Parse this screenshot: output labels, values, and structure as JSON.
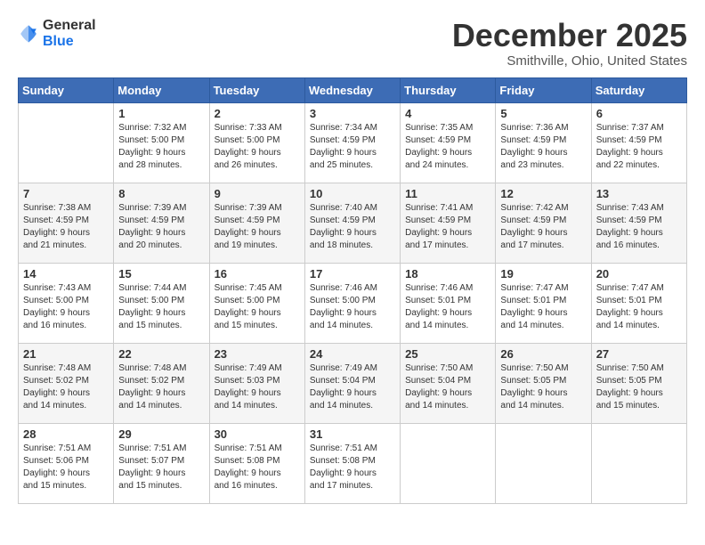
{
  "header": {
    "logo_line1": "General",
    "logo_line2": "Blue",
    "month": "December 2025",
    "location": "Smithville, Ohio, United States"
  },
  "days_of_week": [
    "Sunday",
    "Monday",
    "Tuesday",
    "Wednesday",
    "Thursday",
    "Friday",
    "Saturday"
  ],
  "weeks": [
    [
      {
        "day": "",
        "info": ""
      },
      {
        "day": "1",
        "info": "Sunrise: 7:32 AM\nSunset: 5:00 PM\nDaylight: 9 hours\nand 28 minutes."
      },
      {
        "day": "2",
        "info": "Sunrise: 7:33 AM\nSunset: 5:00 PM\nDaylight: 9 hours\nand 26 minutes."
      },
      {
        "day": "3",
        "info": "Sunrise: 7:34 AM\nSunset: 4:59 PM\nDaylight: 9 hours\nand 25 minutes."
      },
      {
        "day": "4",
        "info": "Sunrise: 7:35 AM\nSunset: 4:59 PM\nDaylight: 9 hours\nand 24 minutes."
      },
      {
        "day": "5",
        "info": "Sunrise: 7:36 AM\nSunset: 4:59 PM\nDaylight: 9 hours\nand 23 minutes."
      },
      {
        "day": "6",
        "info": "Sunrise: 7:37 AM\nSunset: 4:59 PM\nDaylight: 9 hours\nand 22 minutes."
      }
    ],
    [
      {
        "day": "7",
        "info": "Sunrise: 7:38 AM\nSunset: 4:59 PM\nDaylight: 9 hours\nand 21 minutes."
      },
      {
        "day": "8",
        "info": "Sunrise: 7:39 AM\nSunset: 4:59 PM\nDaylight: 9 hours\nand 20 minutes."
      },
      {
        "day": "9",
        "info": "Sunrise: 7:39 AM\nSunset: 4:59 PM\nDaylight: 9 hours\nand 19 minutes."
      },
      {
        "day": "10",
        "info": "Sunrise: 7:40 AM\nSunset: 4:59 PM\nDaylight: 9 hours\nand 18 minutes."
      },
      {
        "day": "11",
        "info": "Sunrise: 7:41 AM\nSunset: 4:59 PM\nDaylight: 9 hours\nand 17 minutes."
      },
      {
        "day": "12",
        "info": "Sunrise: 7:42 AM\nSunset: 4:59 PM\nDaylight: 9 hours\nand 17 minutes."
      },
      {
        "day": "13",
        "info": "Sunrise: 7:43 AM\nSunset: 4:59 PM\nDaylight: 9 hours\nand 16 minutes."
      }
    ],
    [
      {
        "day": "14",
        "info": "Sunrise: 7:43 AM\nSunset: 5:00 PM\nDaylight: 9 hours\nand 16 minutes."
      },
      {
        "day": "15",
        "info": "Sunrise: 7:44 AM\nSunset: 5:00 PM\nDaylight: 9 hours\nand 15 minutes."
      },
      {
        "day": "16",
        "info": "Sunrise: 7:45 AM\nSunset: 5:00 PM\nDaylight: 9 hours\nand 15 minutes."
      },
      {
        "day": "17",
        "info": "Sunrise: 7:46 AM\nSunset: 5:00 PM\nDaylight: 9 hours\nand 14 minutes."
      },
      {
        "day": "18",
        "info": "Sunrise: 7:46 AM\nSunset: 5:01 PM\nDaylight: 9 hours\nand 14 minutes."
      },
      {
        "day": "19",
        "info": "Sunrise: 7:47 AM\nSunset: 5:01 PM\nDaylight: 9 hours\nand 14 minutes."
      },
      {
        "day": "20",
        "info": "Sunrise: 7:47 AM\nSunset: 5:01 PM\nDaylight: 9 hours\nand 14 minutes."
      }
    ],
    [
      {
        "day": "21",
        "info": "Sunrise: 7:48 AM\nSunset: 5:02 PM\nDaylight: 9 hours\nand 14 minutes."
      },
      {
        "day": "22",
        "info": "Sunrise: 7:48 AM\nSunset: 5:02 PM\nDaylight: 9 hours\nand 14 minutes."
      },
      {
        "day": "23",
        "info": "Sunrise: 7:49 AM\nSunset: 5:03 PM\nDaylight: 9 hours\nand 14 minutes."
      },
      {
        "day": "24",
        "info": "Sunrise: 7:49 AM\nSunset: 5:04 PM\nDaylight: 9 hours\nand 14 minutes."
      },
      {
        "day": "25",
        "info": "Sunrise: 7:50 AM\nSunset: 5:04 PM\nDaylight: 9 hours\nand 14 minutes."
      },
      {
        "day": "26",
        "info": "Sunrise: 7:50 AM\nSunset: 5:05 PM\nDaylight: 9 hours\nand 14 minutes."
      },
      {
        "day": "27",
        "info": "Sunrise: 7:50 AM\nSunset: 5:05 PM\nDaylight: 9 hours\nand 15 minutes."
      }
    ],
    [
      {
        "day": "28",
        "info": "Sunrise: 7:51 AM\nSunset: 5:06 PM\nDaylight: 9 hours\nand 15 minutes."
      },
      {
        "day": "29",
        "info": "Sunrise: 7:51 AM\nSunset: 5:07 PM\nDaylight: 9 hours\nand 15 minutes."
      },
      {
        "day": "30",
        "info": "Sunrise: 7:51 AM\nSunset: 5:08 PM\nDaylight: 9 hours\nand 16 minutes."
      },
      {
        "day": "31",
        "info": "Sunrise: 7:51 AM\nSunset: 5:08 PM\nDaylight: 9 hours\nand 17 minutes."
      },
      {
        "day": "",
        "info": ""
      },
      {
        "day": "",
        "info": ""
      },
      {
        "day": "",
        "info": ""
      }
    ]
  ]
}
